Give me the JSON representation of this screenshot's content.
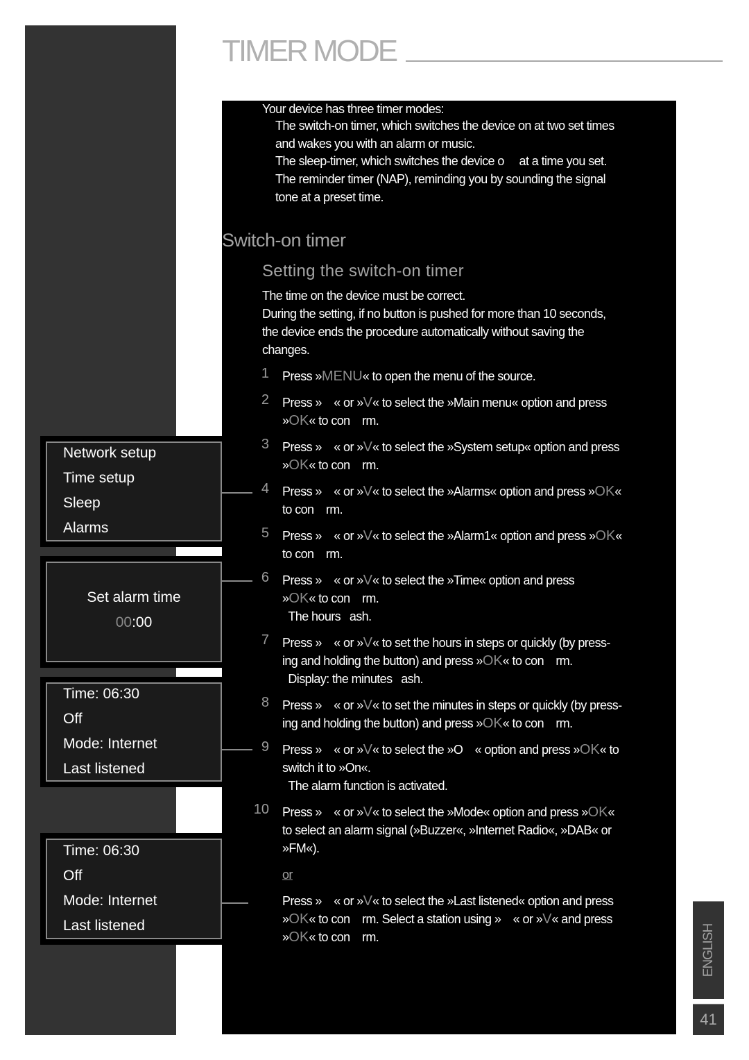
{
  "header": {
    "title": "TIMER MODE"
  },
  "intro": {
    "lead": "Your device has three timer modes:",
    "lines": [
      "The switch-on timer, which switches the device on at two set times",
      "and wakes you with an alarm or music.",
      "The sleep-timer, which switches the device o  at a time you set.",
      "The reminder timer (NAP), reminding you by sounding the signal",
      "tone at a preset time."
    ]
  },
  "section": {
    "heading": "Switch-on timer",
    "subheading": "Setting the switch-on timer",
    "notes": [
      "The time on the device must be correct.",
      "During the setting, if no button is pushed for more than 10 seconds,",
      "the device ends the procedure automatically without saving the",
      "changes."
    ]
  },
  "steps": [
    {
      "n": "1",
      "lines": [
        "Press »<k>MENU</k>« to open the menu of the source."
      ]
    },
    {
      "n": "2",
      "lines": [
        "Press » « or »<k>V</k>« to select the »Main menu« option and press",
        "»<k>OK</k>« to con rm."
      ]
    },
    {
      "n": "3",
      "lines": [
        "Press » « or »<k>V</k>« to select the »System setup« option and press",
        "»<k>OK</k>« to con rm."
      ]
    },
    {
      "n": "4",
      "lines": [
        "Press » « or »<k>V</k>« to select the »Alarms« option and press »<k>OK</k>«",
        "to con rm."
      ]
    },
    {
      "n": "5",
      "lines": [
        "Press » « or »<k>V</k>« to select the »Alarm1« option and press »<k>OK</k>«",
        "to con rm."
      ]
    },
    {
      "n": "6",
      "lines": [
        "Press » « or »<k>V</k>« to select the »Time« option and press",
        "»<k>OK</k>« to con rm.",
        " The hours  ash."
      ]
    },
    {
      "n": "7",
      "lines": [
        "Press » « or »<k>V</k>« to set the hours in steps or quickly (by press-",
        "ing and holding the button) and press »<k>OK</k>« to con rm.",
        " Display: the minutes  ash."
      ]
    },
    {
      "n": "8",
      "lines": [
        "Press » « or »<k>V</k>« to set the minutes in steps or quickly (by press-",
        "ing and holding the button) and press »<k>OK</k>« to con rm."
      ]
    },
    {
      "n": "9",
      "lines": [
        "Press » « or »<k>V</k>« to select the »O « option and press »<k>OK</k>« to",
        "switch it to »On«.",
        " The alarm function is activated."
      ]
    },
    {
      "n": "10",
      "lines": [
        "Press » « or »<k>V</k>« to select the »Mode« option and press »<k>OK</k>«",
        "to select an alarm signal (»Buzzer«, »Internet Radio«, »DAB« or",
        "»FM«)."
      ]
    }
  ],
  "or_label": "or",
  "alt_step": {
    "lines": [
      "Press » « or »<k>V</k>« to select the »Last listened« option and press",
      "»<k>OK</k>« to con rm. Select a station using » « or »<k>V</k>« and press",
      "»<k>OK</k>« to con rm."
    ]
  },
  "displays": {
    "menu": {
      "items": [
        "Network setup",
        "Time setup",
        "Sleep",
        "Alarms"
      ]
    },
    "set_alarm": {
      "label": "Set alarm time",
      "hours": "00",
      "sep": ":",
      "minutes": "00"
    },
    "alarm1": {
      "items": [
        "Time: 06:30",
        "Off",
        "Mode: Internet",
        "Last listened"
      ]
    },
    "alarm2": {
      "items": [
        "Time: 06:30",
        "Off",
        "Mode: Internet",
        "Last listened"
      ]
    }
  },
  "footer": {
    "language": "ENGLISH",
    "page_number": "41"
  },
  "colors": {
    "sidebar": "#333333",
    "text_block": "#000000",
    "accent_gray": "#9a9a9a",
    "title": "#b0b0b0"
  }
}
